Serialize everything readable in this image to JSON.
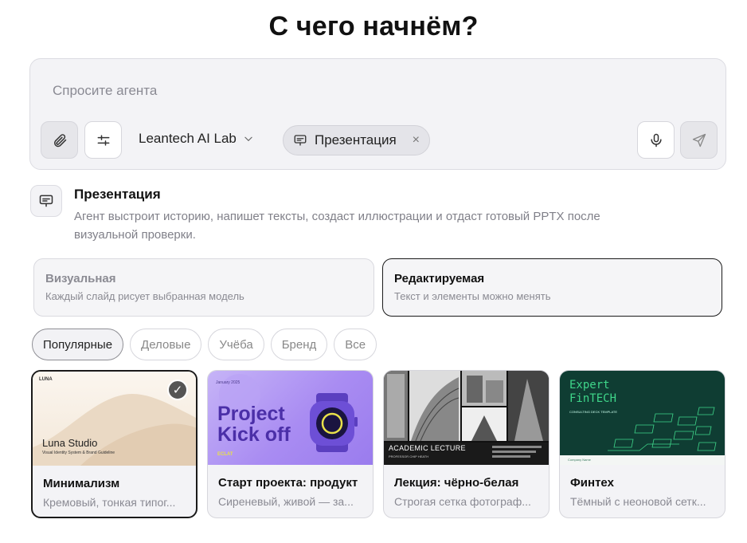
{
  "heading": "С чего начнём?",
  "composer": {
    "placeholder": "Спросите агента",
    "model": "Leantech AI Lab",
    "chip_label": "Презентация",
    "chip_close": "×"
  },
  "info": {
    "title": "Презентация",
    "description": "Агент выстроит историю, напишет тексты, создаст иллюстрации и отдаст готовый PPTX после визуальной проверки."
  },
  "modes": [
    {
      "title": "Визуальная",
      "desc": "Каждый слайд рисует выбранная модель"
    },
    {
      "title": "Редактируемая",
      "desc": "Текст и элементы можно менять"
    }
  ],
  "filters": [
    "Популярные",
    "Деловые",
    "Учёба",
    "Бренд",
    "Все"
  ],
  "templates": [
    {
      "title": "Минимализм",
      "desc": "Кремовый, тонкая типог...",
      "thumb": {
        "brand": "LUNA",
        "heading": "Luna Studio",
        "sub": "Visual Identity System & Brand Guideline"
      }
    },
    {
      "title": "Старт проекта: продукт",
      "desc": "Сиреневый, живой — за...",
      "thumb": {
        "line1": "Project",
        "line2": "Kick off",
        "brand": "ECLAT",
        "date": "January 2025"
      }
    },
    {
      "title": "Лекция: чёрно-белая",
      "desc": "Строгая сетка фотограф...",
      "thumb": {
        "heading": "ACADEMIC LECTURE",
        "sub": "PROFESSOR CHIP HEATH"
      }
    },
    {
      "title": "Финтех",
      "desc": "Тёмный с неоновой сетк...",
      "thumb": {
        "line1": "Expert",
        "line2": "FinTECH",
        "sub": "CONSULTING DECK TEMPLATE",
        "footer": "Company Name"
      }
    }
  ],
  "colors": {
    "accent": "#1a1a1a",
    "purple": "#a98cf2",
    "fintech_bg": "#0f3d33",
    "fintech_text": "#3fd68a"
  }
}
